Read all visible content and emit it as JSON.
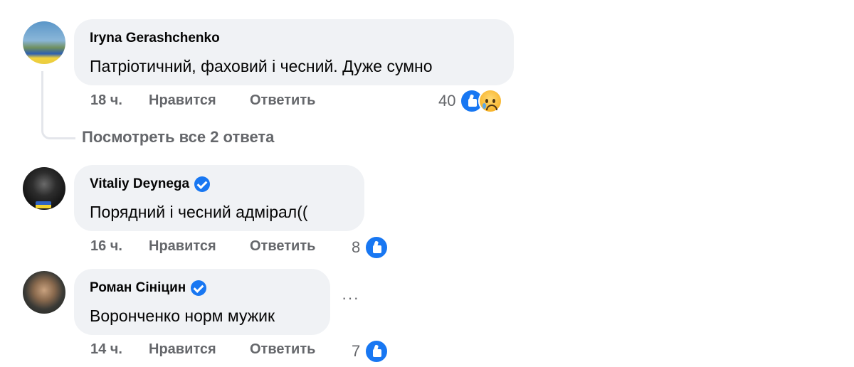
{
  "comments": [
    {
      "author": "Iryna Gerashchenko",
      "text": "Патріотичний, фаховий і чесний. Дуже сумно",
      "time": "18 ч.",
      "like_label": "Нравится",
      "reply_label": "Ответить",
      "reaction_count": "40",
      "reactions": [
        "like-icon",
        "sad-icon"
      ],
      "verified": false
    },
    {
      "author": "Vitaliy Deynega",
      "text": "Порядний і чесний адмірал((",
      "time": "16 ч.",
      "like_label": "Нравится",
      "reply_label": "Ответить",
      "reaction_count": "8",
      "reactions": [
        "like-icon"
      ],
      "verified": true
    },
    {
      "author": "Роман Сініцин",
      "text": "Воронченко норм мужик",
      "time": "14 ч.",
      "like_label": "Нравится",
      "reply_label": "Ответить",
      "reaction_count": "7",
      "reactions": [
        "like-icon"
      ],
      "verified": true
    }
  ],
  "view_replies": "Посмотреть все 2 ответа",
  "more_options": "···",
  "colors": {
    "bubble": "#f0f2f5",
    "accent": "#1877f2",
    "secondary_text": "#65676b"
  }
}
